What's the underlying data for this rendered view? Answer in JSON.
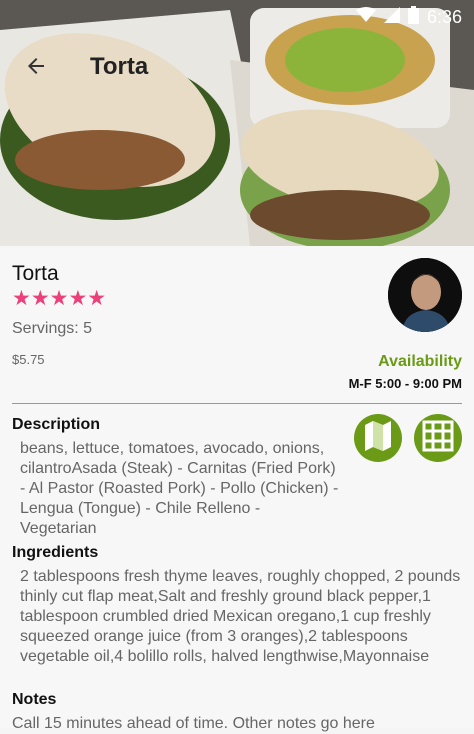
{
  "statusbar": {
    "time": "6:36"
  },
  "toolbar": {
    "title": "Torta"
  },
  "item": {
    "name": "Torta",
    "rating": 5,
    "rating_stars": "★★★★★",
    "servings": "Servings: 5",
    "price": "$5.75",
    "availability_label": "Availability",
    "hours": "M-F 5:00 - 9:00 PM"
  },
  "sections": {
    "description_title": "Description",
    "description_text": "beans, lettuce, tomatoes, avocado, onions, cilantroAsada (Steak) - Carnitas (Fried Pork) - Al Pastor (Roasted Pork) - Pollo (Chicken) - Lengua (Tongue) - Chile Relleno - Vegetarian",
    "ingredients_title": "Ingredients",
    "ingredients_text": "2 tablespoons fresh thyme leaves, roughly chopped, 2 pounds thinly cut flap meat,Salt and freshly ground black pepper,1 tablespoon crumbled dried Mexican oregano,1 cup freshly squeezed orange juice (from 3 oranges),2 tablespoons vegetable oil,4 bolillo rolls, halved lengthwise,Mayonnaise",
    "notes_title": "Notes",
    "notes_text": "Call 15 minutes ahead of time. Other notes go here"
  },
  "icons": {
    "back": "arrow-back-icon",
    "map": "map-icon",
    "grid": "grid-icon",
    "accent_green": "#6a9a16",
    "star_pink": "#ec407a"
  }
}
